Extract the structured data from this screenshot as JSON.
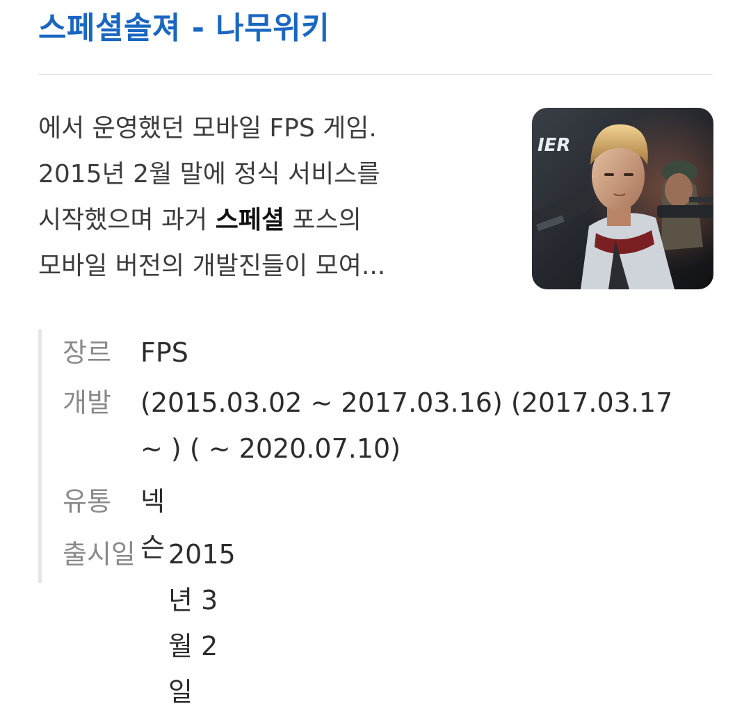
{
  "result": {
    "title": "스페셜솔져 - 나무위키",
    "snippet": {
      "lines": [
        "에서 운영했던 모바일 FPS 게임.",
        "2015년 2월 말에 정식 서비스를",
        {
          "before": "시작했으며 과거 ",
          "bold": "스페셜",
          "after": " 포스의"
        },
        "모바일 버전의 개발진들이 모여..."
      ]
    },
    "thumbnail": {
      "icon": "game-poster-image",
      "logo_fragment": "IER"
    },
    "info": {
      "genre": {
        "label": "장르",
        "value": "FPS"
      },
      "developer": {
        "label": "개발",
        "value_line1": "(2015.03.02 ~ 2017.03.16) (2017.03.17",
        "value_line2": "~ ) ( ~ 2020.07.10)"
      },
      "publisher": {
        "label": "유통",
        "value": "넥슨"
      },
      "release": {
        "label": "출시일",
        "value": "2015년 3월 2일"
      }
    }
  },
  "colors": {
    "title_link": "#1a67c2",
    "body_text": "#3c3c3c",
    "label_text": "#8a8a8a",
    "divider": "#e9e9e9",
    "info_border": "#e6e6e6"
  }
}
